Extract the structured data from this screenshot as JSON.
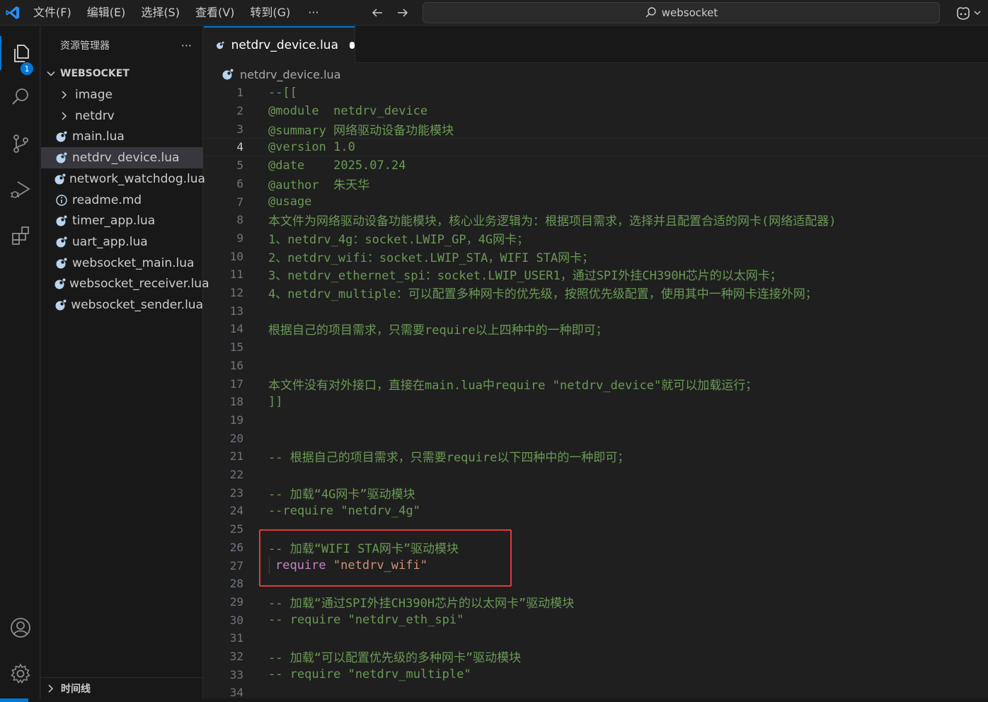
{
  "menu": [
    "文件(F)",
    "编辑(E)",
    "选择(S)",
    "查看(V)",
    "转到(G)",
    "···"
  ],
  "search": {
    "text": "websocket"
  },
  "activity": {
    "explorer_badge": "1"
  },
  "sidebar": {
    "title": "资源管理器",
    "more": "···",
    "folder": "WEBSOCKET",
    "items": [
      {
        "label": "image",
        "type": "folder"
      },
      {
        "label": "netdrv",
        "type": "folder"
      },
      {
        "label": "main.lua",
        "type": "lua"
      },
      {
        "label": "netdrv_device.lua",
        "type": "lua",
        "selected": true
      },
      {
        "label": "network_watchdog.lua",
        "type": "lua"
      },
      {
        "label": "readme.md",
        "type": "md"
      },
      {
        "label": "timer_app.lua",
        "type": "lua"
      },
      {
        "label": "uart_app.lua",
        "type": "lua"
      },
      {
        "label": "websocket_main.lua",
        "type": "lua"
      },
      {
        "label": "websocket_receiver.lua",
        "type": "lua"
      },
      {
        "label": "websocket_sender.lua",
        "type": "lua"
      }
    ],
    "timeline": "时间线"
  },
  "editor": {
    "tab_label": "netdrv_device.lua",
    "breadcrumb": "netdrv_device.lua",
    "current_line": 4,
    "lines": [
      "--[[",
      "@module  netdrv_device",
      "@summary 网络驱动设备功能模块",
      "@version 1.0",
      "@date    2025.07.24",
      "@author  朱天华",
      "@usage",
      "本文件为网络驱动设备功能模块，核心业务逻辑为：根据项目需求，选择并且配置合适的网卡(网络适配器)",
      "1、netdrv_4g：socket.LWIP_GP，4G网卡；",
      "2、netdrv_wifi：socket.LWIP_STA，WIFI STA网卡；",
      "3、netdrv_ethernet_spi：socket.LWIP_USER1，通过SPI外挂CH390H芯片的以太网卡；",
      "4、netdrv_multiple：可以配置多种网卡的优先级，按照优先级配置，使用其中一种网卡连接外网；",
      "",
      "根据自己的项目需求，只需要require以上四种中的一种即可；",
      "",
      "",
      "本文件没有对外接口，直接在main.lua中require \"netdrv_device\"就可以加载运行；",
      "]]",
      "",
      "",
      "-- 根据自己的项目需求，只需要require以下四种中的一种即可；",
      "",
      "-- 加载“4G网卡”驱动模块",
      "--require \"netdrv_4g\"",
      "",
      "-- 加载“WIFI STA网卡”驱动模块",
      "require \"netdrv_wifi\"",
      "",
      "-- 加载“通过SPI外挂CH390H芯片的以太网卡”驱动模块",
      "-- require \"netdrv_eth_spi\"",
      "",
      "-- 加载“可以配置优先级的多种网卡”驱动模块",
      "-- require \"netdrv_multiple\"",
      ""
    ]
  },
  "colors": {
    "accent": "#0078d4",
    "comment": "#6a9955",
    "keyword": "#c586c0",
    "string": "#ce9178",
    "highlight_box": "#e03a3a"
  }
}
